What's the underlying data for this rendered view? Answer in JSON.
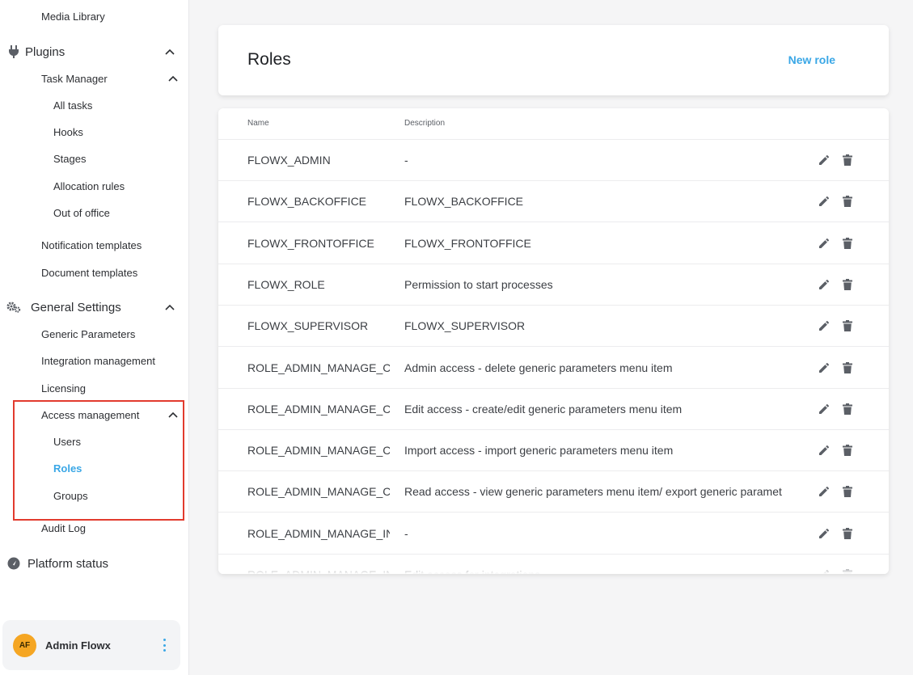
{
  "sidebar": {
    "media_library": "Media Library",
    "plugins": "Plugins",
    "task_manager": "Task Manager",
    "task_items": [
      "All tasks",
      "Hooks",
      "Stages",
      "Allocation rules",
      "Out of office"
    ],
    "notification_templates": "Notification templates",
    "document_templates": "Document templates",
    "general_settings": "General Settings",
    "generic_parameters": "Generic Parameters",
    "integration_management": "Integration management",
    "licensing": "Licensing",
    "access_management": "Access management",
    "access_items": [
      "Users",
      "Roles",
      "Groups"
    ],
    "active_item": "Roles",
    "audit_log": "Audit Log",
    "platform_status": "Platform status",
    "icons": {
      "plugins": "plug-icon",
      "general_settings": "gears-icon",
      "platform_status": "gauge-icon"
    }
  },
  "user": {
    "initials": "AF",
    "name": "Admin Flowx"
  },
  "header": {
    "title": "Roles",
    "new_role": "New role"
  },
  "table": {
    "columns": [
      "Name",
      "Description"
    ],
    "rows": [
      {
        "name": "FLOWX_ADMIN",
        "description": "-"
      },
      {
        "name": "FLOWX_BACKOFFICE",
        "description": "FLOWX_BACKOFFICE"
      },
      {
        "name": "FLOWX_FRONTOFFICE",
        "description": "FLOWX_FRONTOFFICE"
      },
      {
        "name": "FLOWX_ROLE",
        "description": "Permission to start processes"
      },
      {
        "name": "FLOWX_SUPERVISOR",
        "description": "FLOWX_SUPERVISOR"
      },
      {
        "name": "ROLE_ADMIN_MANAGE_C",
        "description": "Admin access - delete generic parameters menu item"
      },
      {
        "name": "ROLE_ADMIN_MANAGE_C",
        "description": "Edit access - create/edit generic parameters menu item"
      },
      {
        "name": "ROLE_ADMIN_MANAGE_C",
        "description": "Import access - import generic parameters menu item"
      },
      {
        "name": "ROLE_ADMIN_MANAGE_C",
        "description": "Read access - view generic parameters menu item/ export generic paramet"
      },
      {
        "name": "ROLE_ADMIN_MANAGE_IN",
        "description": "-"
      },
      {
        "name": "ROLE_ADMIN_MANAGE_IN",
        "description": "Edit access for integrations"
      }
    ],
    "row_icons": [
      "pencil-icon",
      "trash-icon"
    ]
  },
  "colors": {
    "accent": "#3aa7e6",
    "highlight": "#e23b2e",
    "avatar": "#f5a623"
  }
}
